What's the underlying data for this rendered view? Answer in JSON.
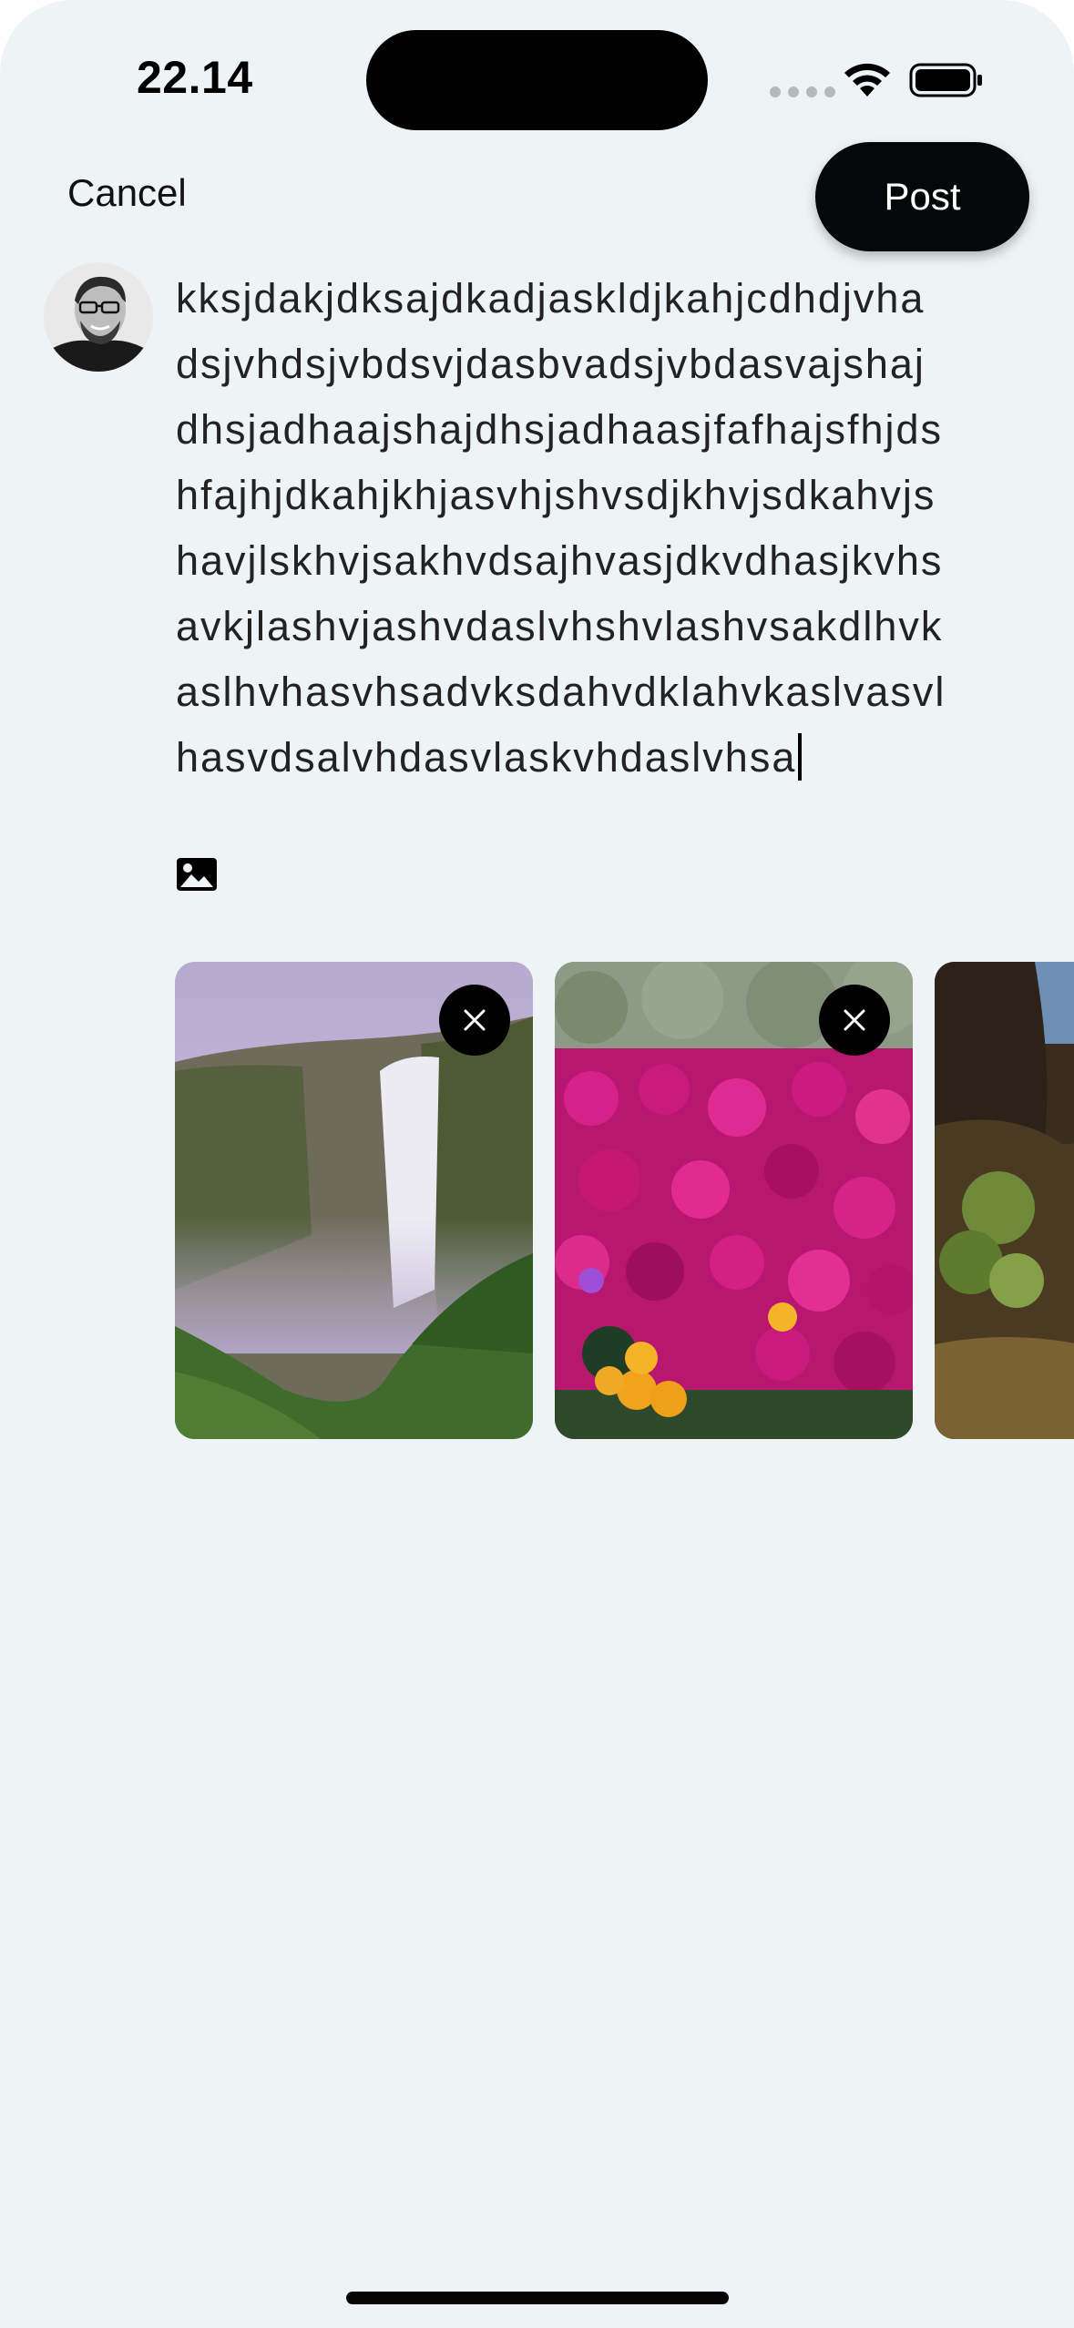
{
  "status_bar": {
    "time": "22.14",
    "icons": [
      "cellular-signal-icon",
      "wifi-icon",
      "battery-icon"
    ]
  },
  "header": {
    "cancel_label": "Cancel",
    "post_label": "Post"
  },
  "composer": {
    "avatar": "user-avatar",
    "text": "kksjdakjdksajdkadjaskldjkahjcdhdjvha\ndsjvhdsjvbdsvjdasbvadsjvbdasvajshaj\ndhsjadhaajshajdhsjadhaasjfafhajsfhjds\nhfajhjdkahjkhjasvhjshvsdjkhvjsdkahvjs\nhavjlskhvjsakhvdsajhvasjdkvdhasjkvhs\navkjlashvjashvdaslvhshvlashvsakdlhvk\naslhvhasvhsadvksdahvdklahvkaslvasvl\nhasvdsalvhdasvlaskvhdaslvhsa",
    "media_button_icon": "image-icon"
  },
  "attachments": [
    {
      "name": "waterfall-photo",
      "removable": true
    },
    {
      "name": "pink-flowers-photo",
      "removable": true
    },
    {
      "name": "rocky-coast-photo",
      "removable": false
    }
  ],
  "colors": {
    "background": "#eef4f6",
    "post_button": "#050808",
    "text": "#222222"
  }
}
